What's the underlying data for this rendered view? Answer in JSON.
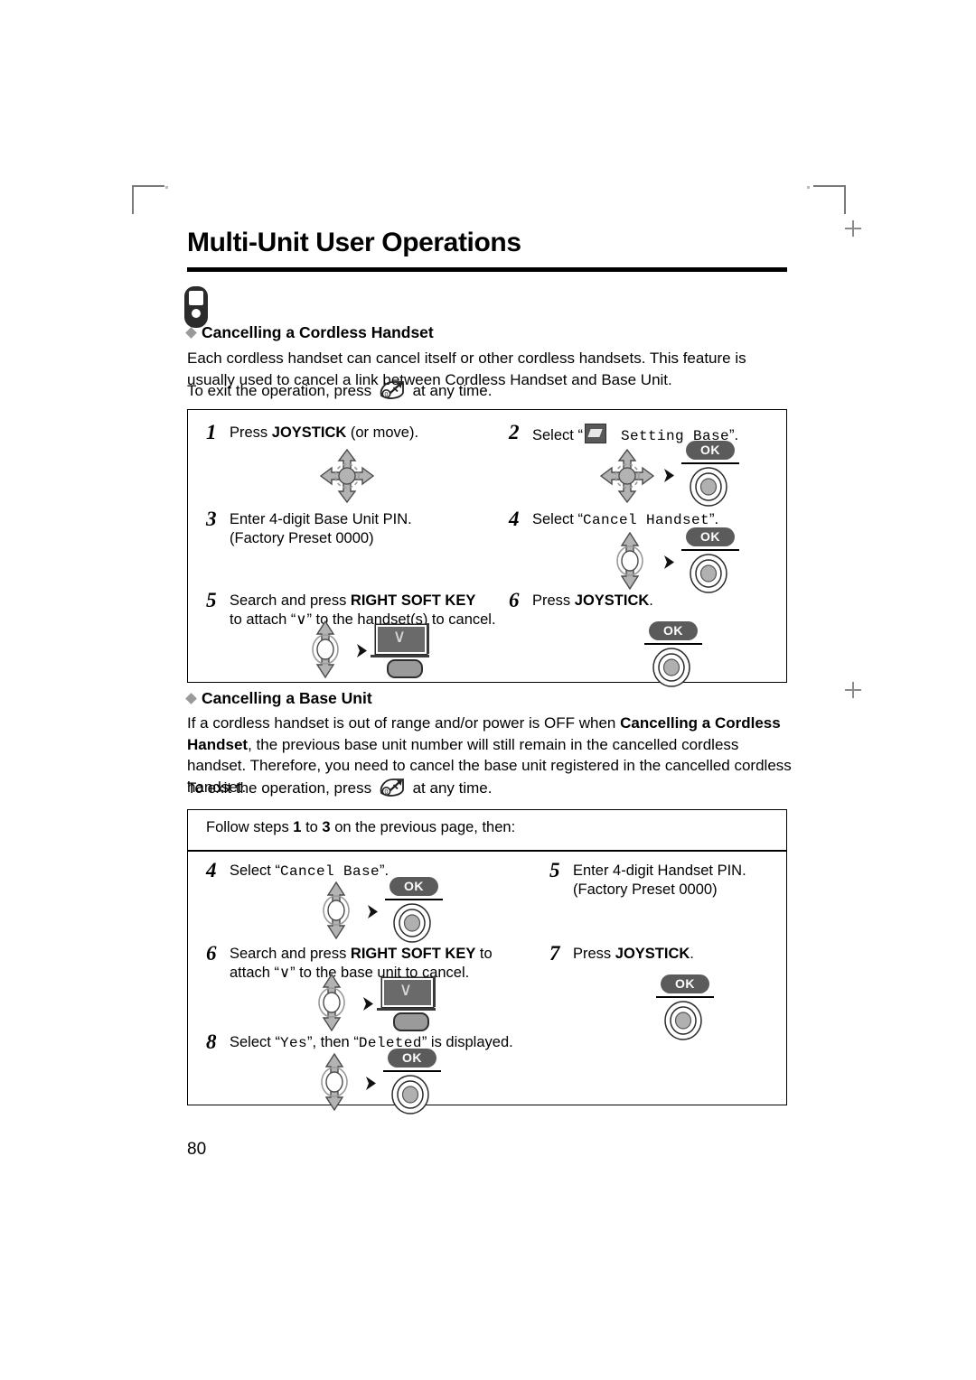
{
  "page": {
    "title": "Multi-Unit User Operations",
    "number": "80"
  },
  "section1": {
    "heading": "Cancelling a Cordless Handset",
    "paragraph": "Each cordless handset can cancel itself or other cordless handsets. This feature is usually used to cancel a link between Cordless Handset and Base Unit.",
    "exit_prefix": "To exit the operation, press",
    "exit_suffix": "at any time.",
    "steps": [
      {
        "num": "1",
        "text_a": "Press ",
        "bold": "JOYSTICK",
        "text_b": " (or move)."
      },
      {
        "num": "2",
        "text_a": "Select “",
        "mono": "Setting Base",
        "text_b": "”."
      },
      {
        "num": "3",
        "line1": "Enter 4-digit Base Unit PIN.",
        "line2": "(Factory Preset 0000)"
      },
      {
        "num": "4",
        "text_a": "Select “",
        "mono": "Cancel Handset",
        "text_b": "”."
      },
      {
        "num": "5",
        "line1_a": "Search and press ",
        "line1_bold": "RIGHT SOFT KEY",
        "line2": "to attach “∨” to the handset(s) to cancel."
      },
      {
        "num": "6",
        "text_a": "Press ",
        "bold": "JOYSTICK",
        "text_b": "."
      }
    ]
  },
  "section2": {
    "heading": "Cancelling a Base Unit",
    "paragraph_1": "If a cordless handset is out of range and/or power is OFF when ",
    "paragraph_bold_1": "Cancelling a Cordless Handset",
    "paragraph_2": ", the previous base unit number will still remain in the cancelled cordless handset. Therefore, you need to cancel the base unit registered in the cancelled cordless handset.",
    "exit_prefix": "To exit the operation, press",
    "exit_suffix": "at any time.",
    "follow_a": "Follow steps ",
    "follow_b1": "1",
    "follow_mid": " to ",
    "follow_b2": "3",
    "follow_c": " on the previous page, then:",
    "steps": [
      {
        "num": "4",
        "text_a": "Select “",
        "mono": "Cancel Base",
        "text_b": "”."
      },
      {
        "num": "5",
        "line1": "Enter 4-digit Handset PIN.",
        "line2": "(Factory Preset 0000)"
      },
      {
        "num": "6",
        "line1_a": "Search and press ",
        "line1_bold": "RIGHT SOFT KEY",
        "line1_c": " to",
        "line2": "attach “∨” to the base unit to cancel."
      },
      {
        "num": "7",
        "text_a": "Press ",
        "bold": "JOYSTICK",
        "text_b": "."
      },
      {
        "num": "8",
        "text_a": "Select “",
        "mono": "Yes",
        "text_b": "”, then “",
        "mono2": "Deleted",
        "text_c": "” is displayed."
      }
    ]
  },
  "icons": {
    "ok_label": "OK",
    "softkey_glyph": "∨"
  },
  "colors": {
    "rule": "#000000",
    "ok_pill": "#5b5b5b",
    "icon_gray": "#9a9a9a",
    "diamond": "#9a9a9a"
  }
}
